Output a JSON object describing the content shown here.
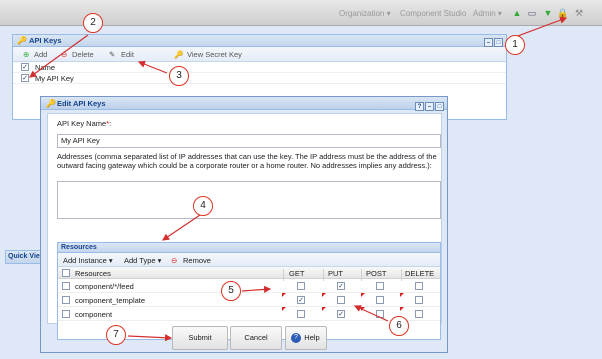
{
  "topbar": {
    "menus": [
      "Organization ▾",
      "Component Studio",
      "Admin ▾"
    ]
  },
  "api_keys_window": {
    "title": "API Keys",
    "toolbar": {
      "add": "Add",
      "delete": "Delete",
      "edit": "Edit",
      "view_secret": "View Secret Key"
    },
    "grid": {
      "header": "Name",
      "rows": [
        "My API Key"
      ]
    }
  },
  "quick_view": {
    "title": "Quick Vie"
  },
  "edit_dialog": {
    "title": "Edit API Keys",
    "name_label": "API Key Name",
    "name_required": "*",
    "name_value": "My API Key",
    "addresses_label": "Addresses (comma separated list of IP addresses that can use the key. The IP address must be the address of the outward facing gateway which could be a corporate router or a home router. No addresses implies any address.):",
    "resources": {
      "title": "Resources",
      "toolbar": {
        "add_instance": "Add Instance ▾",
        "add_type": "Add Type ▾",
        "remove": "Remove"
      },
      "columns": [
        "Resources",
        "GET",
        "PUT",
        "POST",
        "DELETE"
      ],
      "rows": [
        {
          "name": "component/*/feed",
          "get": false,
          "put": true,
          "post": false,
          "delete": false
        },
        {
          "name": "component_template",
          "get": true,
          "put": false,
          "post": false,
          "delete": false
        },
        {
          "name": "component",
          "get": false,
          "put": true,
          "post": false,
          "delete": false
        }
      ]
    },
    "buttons": {
      "submit": "Submit",
      "cancel": "Cancel",
      "help": "Help"
    }
  },
  "callouts": [
    "1",
    "2",
    "3",
    "4",
    "5",
    "6",
    "7"
  ],
  "colors": {
    "callout": "#d32f2f",
    "header_blue": "#15428b"
  }
}
